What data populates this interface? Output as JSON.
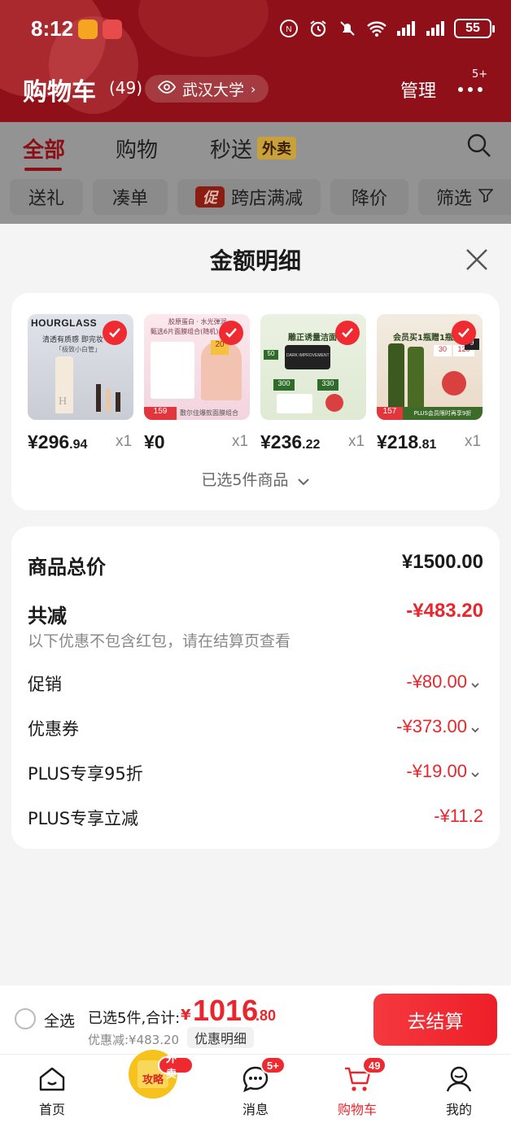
{
  "status_bar": {
    "time": "8:12",
    "battery": "55"
  },
  "header": {
    "title": "购物车",
    "count": "(49)",
    "location": "武汉大学",
    "manage": "管理",
    "more_badge": "5+"
  },
  "tabs": [
    {
      "label": "全部"
    },
    {
      "label": "购物"
    },
    {
      "label": "秒送"
    }
  ],
  "waimai_tag": "外卖",
  "chips": [
    {
      "label": "送礼"
    },
    {
      "label": "凑单"
    },
    {
      "tag": "促",
      "label": "跨店满减"
    },
    {
      "label": "降价"
    },
    {
      "label": "筛选"
    }
  ],
  "sheet": {
    "title": "金额明细",
    "goods": [
      {
        "price_int": "¥296",
        "price_dec": ".94",
        "qty": "x1",
        "brand": "HOURGLASS",
        "tagline": "清透有质感 即完妆",
        "tag2": "「极致小白管」"
      },
      {
        "price_int": "¥0",
        "price_dec": "",
        "qty": "x1",
        "line1": "胶原蛋白 · 水光弹润",
        "line2": "甄选6片面膜组合(随机)",
        "badge": "20",
        "footer": "敷尔佳爆款面膜组合",
        "corner": "159"
      },
      {
        "price_int": "¥236",
        "price_dec": ".22",
        "qty": "x1",
        "headline": "雕正诱量洁面120",
        "product": "DARK IMPROVEMENT",
        "p1": "300",
        "p2": "330",
        "p3": "50"
      },
      {
        "price_int": "¥218",
        "price_dec": ".81",
        "qty": "x1",
        "headline": "会员买1瓶赠1瓶正",
        "p1": "30",
        "p2": "120",
        "p3": "9",
        "corner": "157",
        "footer": "PLUS会员限时再享9折"
      }
    ],
    "selected_summary": "已选5件商品",
    "total_label": "商品总价",
    "total_value": "¥1500.00",
    "reduce_label": "共减",
    "reduce_value": "-¥483.20",
    "reduce_note": "以下优惠不包含红包，请在结算页查看",
    "items": [
      {
        "label": "促销",
        "value": "-¥80.00",
        "expandable": true
      },
      {
        "label": "优惠券",
        "value": "-¥373.00",
        "expandable": true
      },
      {
        "label": "PLUS专享95折",
        "value": "-¥19.00",
        "expandable": true
      },
      {
        "label": "PLUS专享立减",
        "value": "-¥11.2",
        "expandable": false
      }
    ]
  },
  "checkout": {
    "select_all": "全选",
    "selected_info": "已选5件,合计:",
    "currency": "¥",
    "total_int": "1016",
    "total_dec": ".80",
    "discount": "优惠减:¥483.20",
    "detail": "优惠明细",
    "button": "去结算"
  },
  "tabbar": [
    {
      "label": "首页"
    },
    {
      "label": "攻略",
      "badge": "外卖"
    },
    {
      "label": "消息",
      "badge": "5+"
    },
    {
      "label": "购物车",
      "badge": "49"
    },
    {
      "label": "我的"
    }
  ],
  "colors": {
    "accent": "#e8262d",
    "header_dim": "#8f1018",
    "check": "#ef2a30"
  }
}
